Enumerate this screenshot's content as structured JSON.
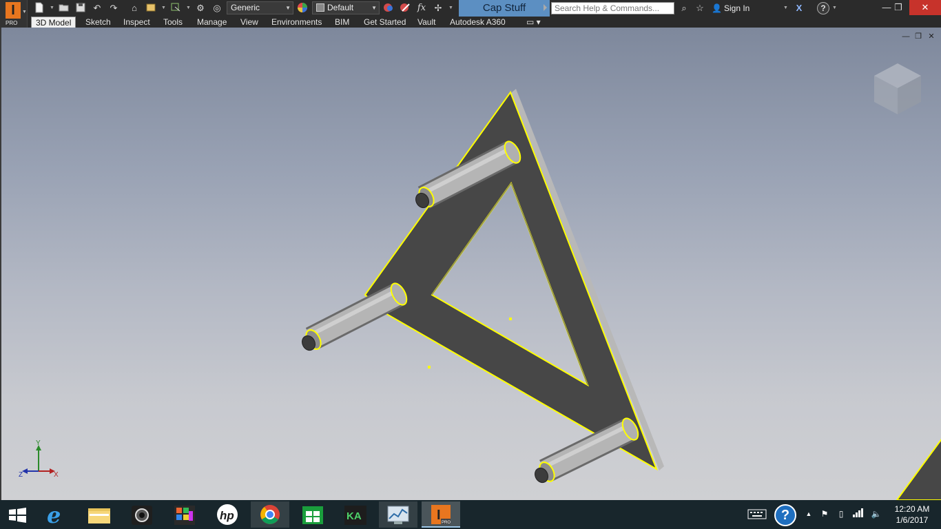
{
  "app": {
    "logo_letter": "I",
    "edition": "PRO",
    "document_title": "Cap Stuff"
  },
  "quick_access": {
    "material_combo": "Generic",
    "appearance_combo": "Default",
    "fx_label": "fx"
  },
  "search": {
    "placeholder": "Search Help & Commands..."
  },
  "account": {
    "sign_in_label": "Sign In"
  },
  "help_icon_label": "?",
  "ribbon_tabs": [
    "3D Model",
    "Sketch",
    "Inspect",
    "Tools",
    "Manage",
    "View",
    "Environments",
    "BIM",
    "Get Started",
    "Vault",
    "Autodesk A360"
  ],
  "active_tab": "3D Model",
  "triad": {
    "x": "X",
    "y": "Y",
    "z": "Z"
  },
  "taskbar": {
    "apps": [
      "windows-start",
      "internet-explorer",
      "file-explorer",
      "webcam",
      "paint-app",
      "hp-support",
      "chrome",
      "windows-store",
      "clip-app",
      "resource-monitor",
      "inventor-pro"
    ],
    "hp_label": "hp",
    "inventor_badge": "PRO"
  },
  "clock": {
    "time": "12:20 AM",
    "date": "1/6/2017"
  },
  "colors": {
    "selection_highlight": "#ffff00",
    "part_face": "#4a4a4a",
    "title_tab": "#5c8fc2",
    "close_button": "#c7332b"
  }
}
